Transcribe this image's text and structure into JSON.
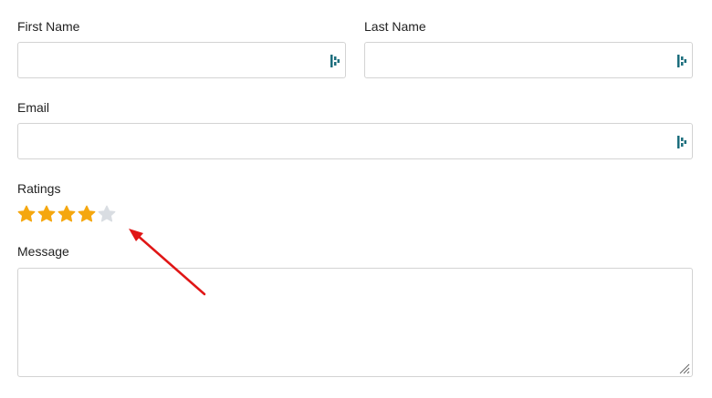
{
  "form": {
    "first_name": {
      "label": "First Name",
      "value": "",
      "placeholder": ""
    },
    "last_name": {
      "label": "Last Name",
      "value": "",
      "placeholder": ""
    },
    "email": {
      "label": "Email",
      "value": "",
      "placeholder": ""
    },
    "ratings": {
      "label": "Ratings",
      "value": 4,
      "max": 5
    },
    "message": {
      "label": "Message",
      "value": "",
      "placeholder": ""
    }
  },
  "colors": {
    "star_filled": "#f5a70f",
    "star_empty": "#d9dde2",
    "field_icon": "#1c6e7d",
    "annotation_arrow": "#e01616"
  },
  "icons": {
    "field_icon": "lastpass-autofill-icon"
  }
}
